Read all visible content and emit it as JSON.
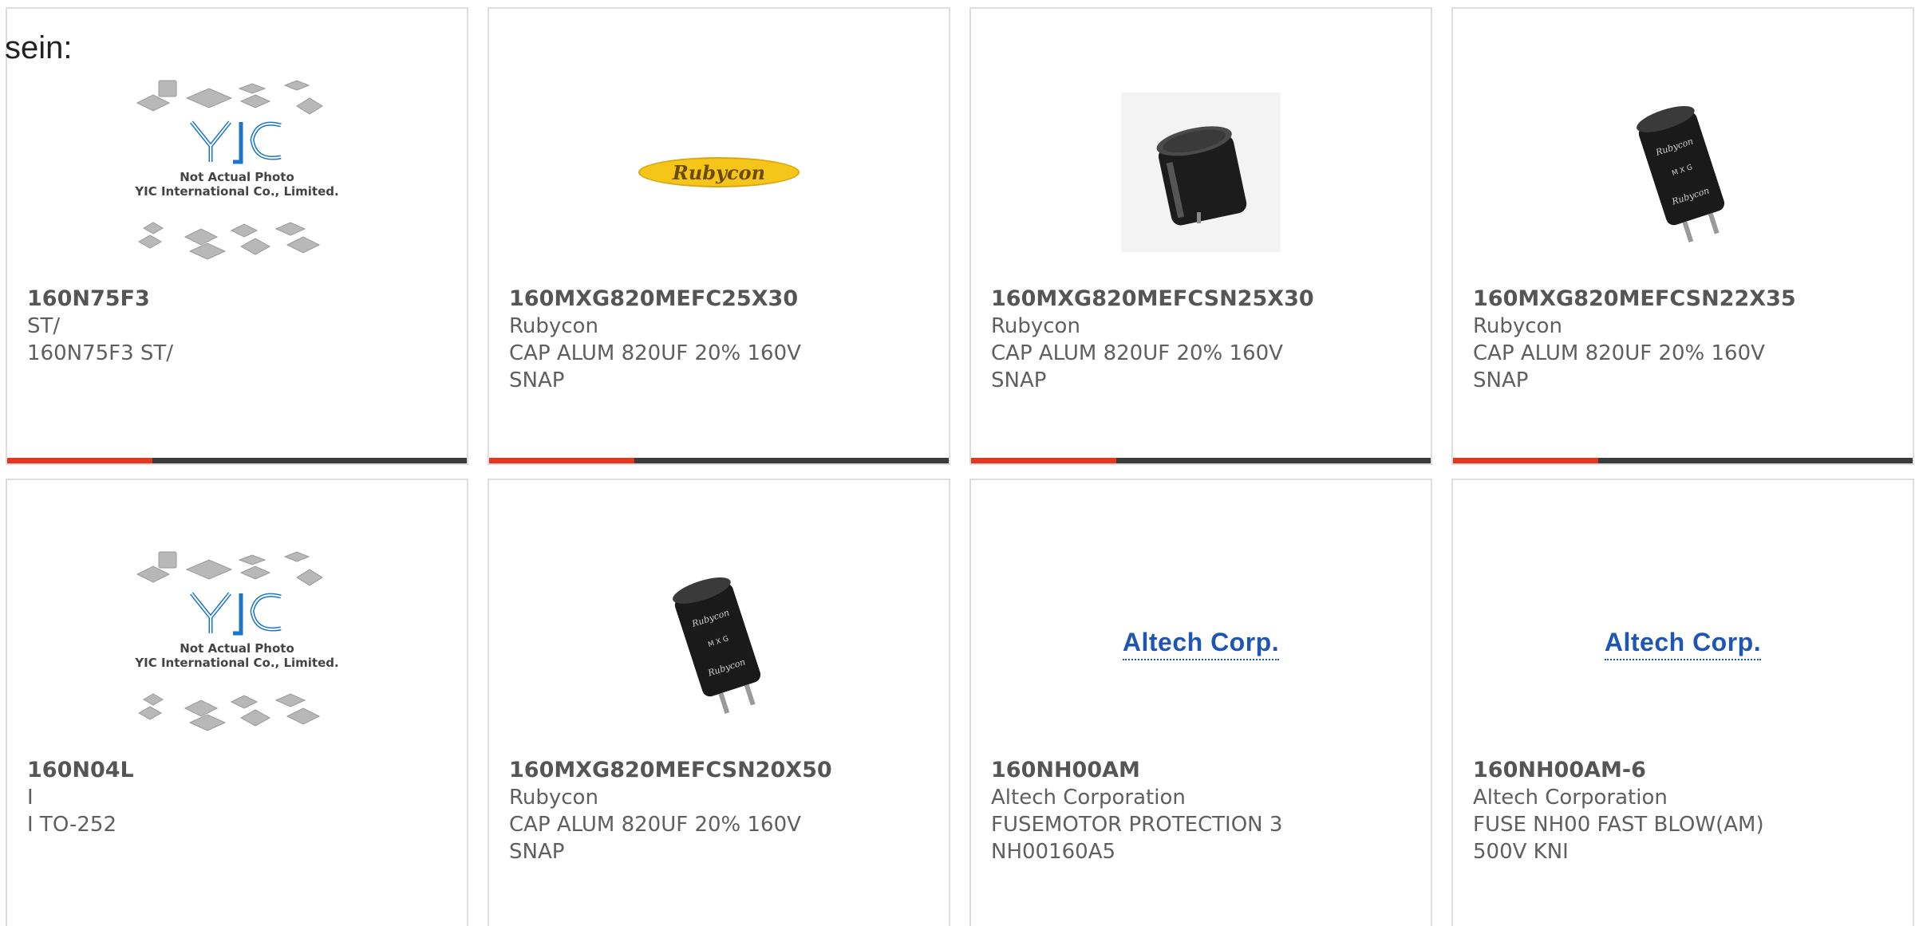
{
  "page": {
    "prefix_text": "sein:"
  },
  "colors": {
    "accent": "#e5371f",
    "bar": "#3c3c3c",
    "border": "#dedede",
    "yic_blue": "#1976c8",
    "rubycon_yellow": "#f5c51a",
    "altech_blue": "#1f56b5"
  },
  "placeholder": {
    "caption_1": "Not Actual Photo",
    "caption_2": "YIC International Co., Limited.",
    "logo_text": "YIC"
  },
  "products": [
    {
      "part_number": "160N75F3",
      "manufacturer": "ST/",
      "description": "160N75F3 ST/",
      "description_2": "",
      "image": "yic-placeholder-icon"
    },
    {
      "part_number": "160MXG820MEFC25X30",
      "manufacturer": "Rubycon",
      "description": "CAP ALUM 820UF 20% 160V",
      "description_2": "SNAP",
      "image": "rubycon-logo",
      "logo_text": "Rubycon"
    },
    {
      "part_number": "160MXG820MEFCSN25X30",
      "manufacturer": "Rubycon",
      "description": "CAP ALUM 820UF 20% 160V",
      "description_2": "SNAP",
      "image": "capacitor-short-icon"
    },
    {
      "part_number": "160MXG820MEFCSN22X35",
      "manufacturer": "Rubycon",
      "description": "CAP ALUM 820UF 20% 160V",
      "description_2": "SNAP",
      "image": "capacitor-tall-icon"
    },
    {
      "part_number": "160N04L",
      "manufacturer": "I",
      "description": "I TO-252",
      "description_2": "",
      "image": "yic-placeholder-icon"
    },
    {
      "part_number": "160MXG820MEFCSN20X50",
      "manufacturer": "Rubycon",
      "description": "CAP ALUM 820UF 20% 160V",
      "description_2": "SNAP",
      "image": "capacitor-tall-icon"
    },
    {
      "part_number": "160NH00AM",
      "manufacturer": "Altech Corporation",
      "description": "FUSEMOTOR PROTECTION 3",
      "description_2": "NH00160A5",
      "image": "altech-logo",
      "logo_text": "Altech Corp."
    },
    {
      "part_number": "160NH00AM-6",
      "manufacturer": "Altech Corporation",
      "description": "FUSE NH00 FAST BLOW(AM)",
      "description_2": "500V KNI",
      "image": "altech-logo",
      "logo_text": "Altech Corp."
    }
  ]
}
